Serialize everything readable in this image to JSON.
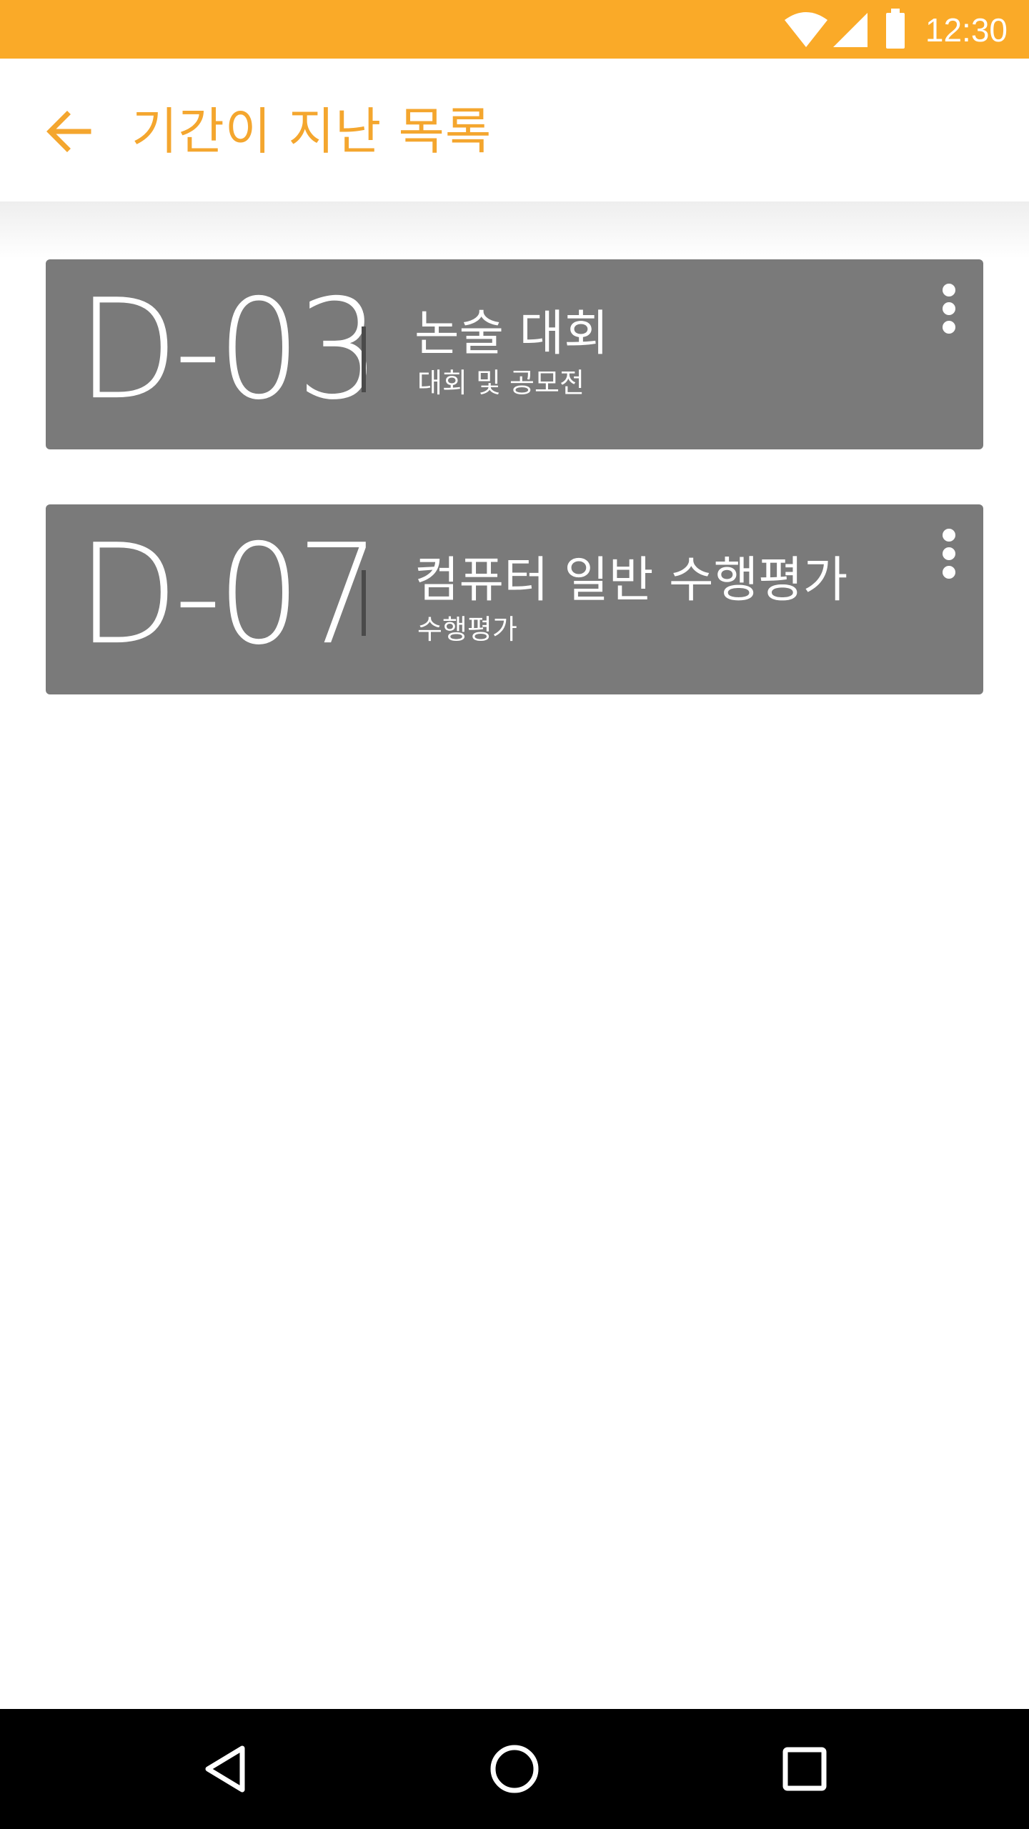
{
  "status_bar": {
    "time": "12:30",
    "background": "#FAAA28",
    "icons": [
      "wifi-icon",
      "cell-signal-icon",
      "battery-icon"
    ]
  },
  "app_bar": {
    "title": "기간이 지난 목록",
    "back_icon": "arrow-back-icon",
    "accent": "#F4A62E"
  },
  "cards": [
    {
      "dday": "D-03",
      "title": "논술 대회",
      "subtitle": "대회 및 공모전",
      "menu_icon": "more-vert-icon"
    },
    {
      "dday": "D-07",
      "title": "컴퓨터 일반 수행평가",
      "subtitle": "수행평가",
      "menu_icon": "more-vert-icon"
    }
  ],
  "card_color": "#7a7a7a",
  "nav_bar": {
    "buttons": [
      "back-triangle-icon",
      "home-circle-icon",
      "recents-square-icon"
    ]
  }
}
